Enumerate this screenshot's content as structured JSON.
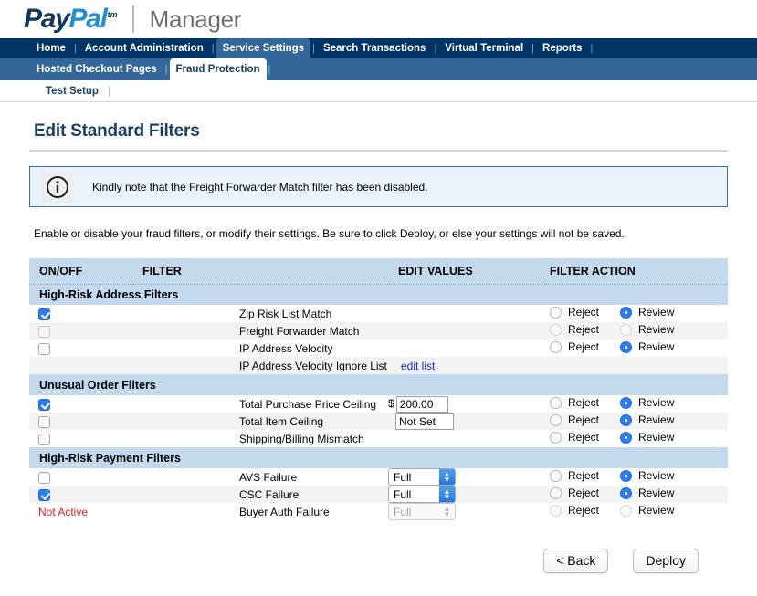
{
  "brand": {
    "logo_pay": "Pay",
    "logo_pal": "Pal",
    "logo_tm": "tm",
    "product": "Manager"
  },
  "nav_primary": [
    {
      "label": "Home",
      "active": false
    },
    {
      "label": "Account Administration",
      "active": false
    },
    {
      "label": "Service Settings",
      "active": true
    },
    {
      "label": "Search Transactions",
      "active": false
    },
    {
      "label": "Virtual Terminal",
      "active": false
    },
    {
      "label": "Reports",
      "active": false
    }
  ],
  "nav_secondary": [
    {
      "label": "Hosted Checkout Pages",
      "active": false
    },
    {
      "label": "Fraud Protection",
      "active": true
    }
  ],
  "nav_tertiary": [
    {
      "label": "Test Setup",
      "active": false
    }
  ],
  "page": {
    "title": "Edit Standard Filters",
    "info_message": "Kindly note that the Freight Forwarder Match filter has been disabled.",
    "info_icon": "info-circle-icon",
    "intro": "Enable or disable your fraud filters, or modify their settings. Be sure to click Deploy, or else your settings will not be saved."
  },
  "table": {
    "headers": {
      "onoff": "ON/OFF",
      "filter": "FILTER",
      "edit_values": "EDIT VALUES",
      "filter_action": "FILTER ACTION"
    },
    "action_labels": {
      "reject": "Reject",
      "review": "Review"
    },
    "groups": [
      {
        "title": "High-Risk Address Filters",
        "rows": [
          {
            "name": "Zip Risk List Match",
            "onoff_type": "checkbox",
            "checked": true,
            "disabled": false,
            "edit_type": "none",
            "action": "review",
            "action_disabled": false
          },
          {
            "name": "Freight Forwarder Match",
            "onoff_type": "checkbox",
            "checked": false,
            "disabled": true,
            "edit_type": "none",
            "action": "none",
            "action_disabled": true
          },
          {
            "name": "IP Address Velocity",
            "onoff_type": "checkbox",
            "checked": false,
            "disabled": false,
            "edit_type": "none",
            "action": "review",
            "action_disabled": false
          },
          {
            "name": "IP Address Velocity Ignore List",
            "onoff_type": "none",
            "checked": false,
            "disabled": false,
            "edit_type": "link",
            "edit_link_label": "edit list",
            "action": "none",
            "action_disabled": false,
            "hide_action": true
          }
        ]
      },
      {
        "title": "Unusual Order Filters",
        "rows": [
          {
            "name": "Total Purchase Price Ceiling",
            "onoff_type": "checkbox",
            "checked": true,
            "disabled": false,
            "edit_type": "currency",
            "edit_prefix": "$",
            "edit_value": "200.00",
            "action": "review",
            "action_disabled": false
          },
          {
            "name": "Total Item Ceiling",
            "onoff_type": "checkbox",
            "checked": false,
            "disabled": false,
            "edit_type": "text",
            "edit_value": "Not Set",
            "action": "review",
            "action_disabled": false
          },
          {
            "name": "Shipping/Billing Mismatch",
            "onoff_type": "checkbox",
            "checked": false,
            "disabled": false,
            "edit_type": "none",
            "action": "review",
            "action_disabled": false
          }
        ]
      },
      {
        "title": "High-Risk Payment Filters",
        "rows": [
          {
            "name": "AVS Failure",
            "onoff_type": "checkbox",
            "checked": false,
            "disabled": false,
            "edit_type": "select",
            "edit_value": "Full",
            "edit_disabled": false,
            "action": "review",
            "action_disabled": false
          },
          {
            "name": "CSC Failure",
            "onoff_type": "checkbox",
            "checked": true,
            "disabled": false,
            "edit_type": "select",
            "edit_value": "Full",
            "edit_disabled": false,
            "action": "review",
            "action_disabled": false
          },
          {
            "name": "Buyer Auth Failure",
            "onoff_type": "text",
            "onoff_text": "Not Active",
            "edit_type": "select",
            "edit_value": "Full",
            "edit_disabled": true,
            "action": "none",
            "action_disabled": true
          }
        ]
      }
    ]
  },
  "footer": {
    "back_label": "< Back",
    "deploy_label": "Deploy"
  },
  "colors": {
    "nav_primary_bg": "#003366",
    "nav_secondary_bg": "#336699",
    "table_header_bg": "#c3d9ed",
    "accent_blue": "#2b7df5",
    "link_blue": "#2020d0",
    "not_active_red": "#f01c1c",
    "title_navy": "#1a3f66"
  }
}
